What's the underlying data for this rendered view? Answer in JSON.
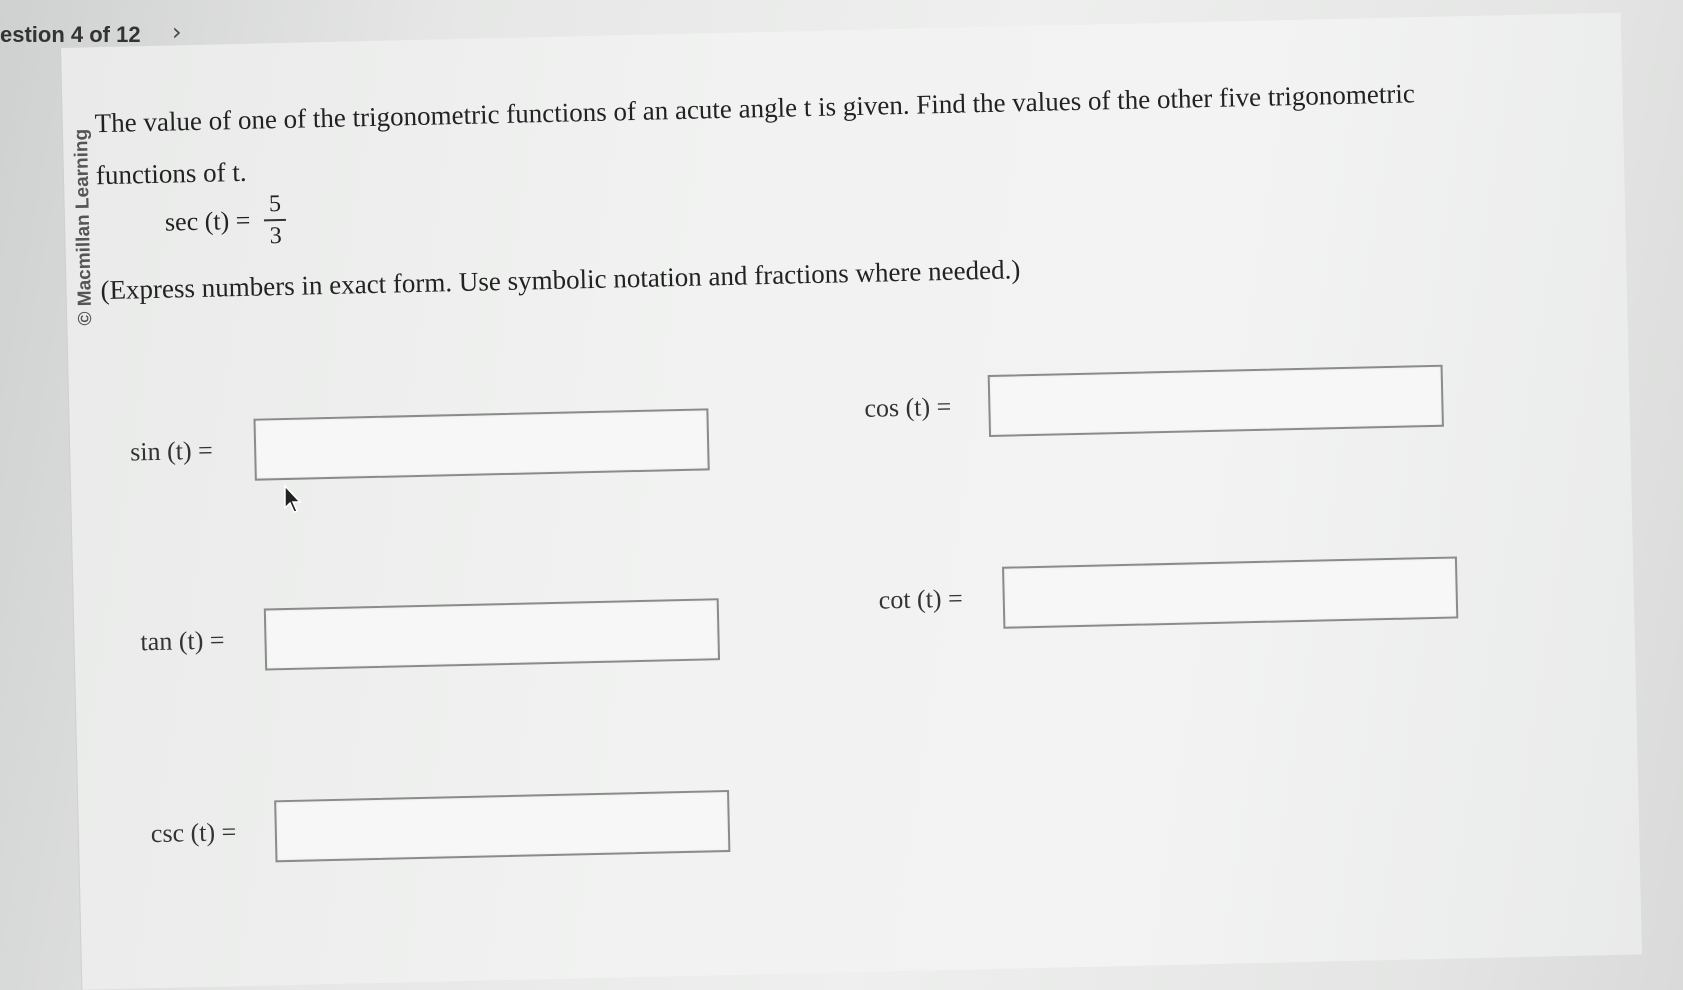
{
  "nav": {
    "label": "estion 4 of 12",
    "next_icon": "chevron-right-icon",
    "next_glyph": "›"
  },
  "copyright": "© Macmillan Learning",
  "question": {
    "prompt": "The value of one of the trigonometric functions of an acute angle t is given. Find the values of the other five trigonometric functions of t.",
    "given_label": "sec (t) =",
    "given_numerator": "5",
    "given_denominator": "3",
    "instructions": "(Express numbers in exact form. Use symbolic notation and fractions where needed.)"
  },
  "answers": [
    {
      "label": "sin (t) =",
      "value": ""
    },
    {
      "label": "cos (t) =",
      "value": ""
    },
    {
      "label": "tan (t) =",
      "value": ""
    },
    {
      "label": "cot (t) =",
      "value": ""
    },
    {
      "label": "csc (t) =",
      "value": ""
    }
  ]
}
